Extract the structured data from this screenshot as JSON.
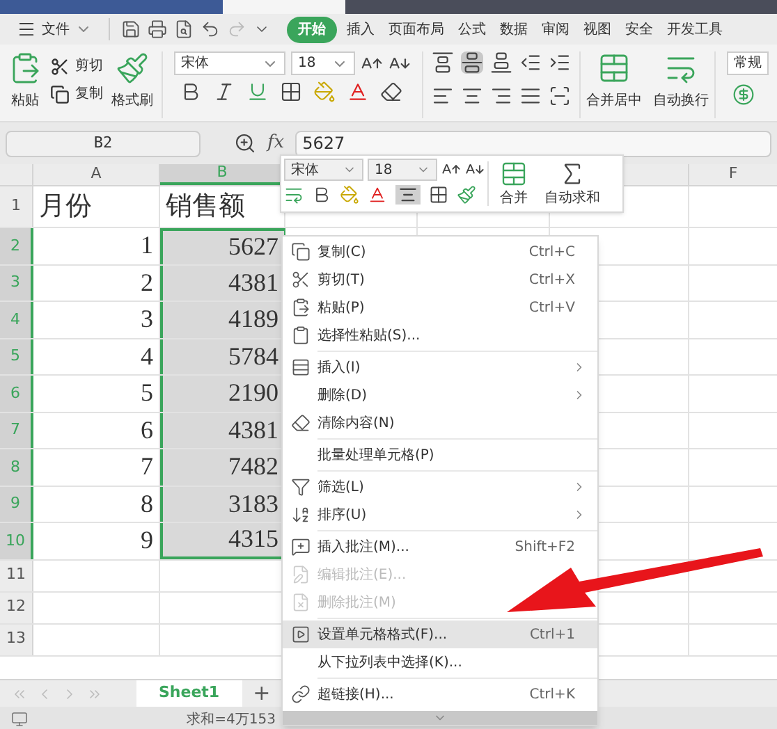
{
  "menu_bar": {
    "file_menu": "文件",
    "tabs": [
      {
        "label": "开始",
        "selected": true
      },
      {
        "label": "插入",
        "selected": false
      },
      {
        "label": "页面布局",
        "selected": false
      },
      {
        "label": "公式",
        "selected": false
      },
      {
        "label": "数据",
        "selected": false
      },
      {
        "label": "审阅",
        "selected": false
      },
      {
        "label": "视图",
        "selected": false
      },
      {
        "label": "安全",
        "selected": false
      },
      {
        "label": "开发工具",
        "selected": false
      }
    ]
  },
  "ribbon": {
    "paste": "粘贴",
    "cut": "剪切",
    "copy": "复制",
    "format_painter": "格式刷",
    "font": "宋体",
    "font_size": "18",
    "merge_center": "合并居中",
    "wrap_text": "自动换行",
    "number_format": "常规"
  },
  "formula_bar": {
    "name_box": "B2",
    "function_label": "fx",
    "formula": "5627"
  },
  "mini_toolbar": {
    "font": "宋体",
    "font_size": "18",
    "merge": "合并",
    "autosum": "自动求和"
  },
  "sheet": {
    "columns": [
      {
        "label": "A",
        "selected": false
      },
      {
        "label": "B",
        "selected": true
      },
      {
        "label": "F",
        "selected": false
      }
    ],
    "rows": [
      {
        "label": "1",
        "selected": false,
        "cells": [
          "月份",
          "销售额"
        ]
      },
      {
        "label": "2",
        "selected": true,
        "cells": [
          "1",
          "5627"
        ]
      },
      {
        "label": "3",
        "selected": true,
        "cells": [
          "2",
          "4381"
        ]
      },
      {
        "label": "4",
        "selected": true,
        "cells": [
          "3",
          "4189"
        ]
      },
      {
        "label": "5",
        "selected": true,
        "cells": [
          "4",
          "5784"
        ]
      },
      {
        "label": "6",
        "selected": true,
        "cells": [
          "5",
          "2190"
        ]
      },
      {
        "label": "7",
        "selected": true,
        "cells": [
          "6",
          "4381"
        ]
      },
      {
        "label": "8",
        "selected": true,
        "cells": [
          "7",
          "7482"
        ]
      },
      {
        "label": "9",
        "selected": true,
        "cells": [
          "8",
          "3183"
        ]
      },
      {
        "label": "10",
        "selected": true,
        "cells": [
          "9",
          "4315"
        ]
      },
      {
        "label": "11",
        "selected": false
      },
      {
        "label": "12",
        "selected": false
      },
      {
        "label": "13",
        "selected": false
      }
    ]
  },
  "context_menu": [
    {
      "kind": "item",
      "label": "复制(C)",
      "shortcut": "Ctrl+C",
      "disabled": false,
      "selected": false,
      "submenu": false
    },
    {
      "kind": "item",
      "label": "剪切(T)",
      "shortcut": "Ctrl+X",
      "disabled": false,
      "selected": false,
      "submenu": false
    },
    {
      "kind": "item",
      "label": "粘贴(P)",
      "shortcut": "Ctrl+V",
      "disabled": false,
      "selected": false,
      "submenu": false
    },
    {
      "kind": "item",
      "label": "选择性粘贴(S)...",
      "disabled": false,
      "selected": false,
      "submenu": false
    },
    {
      "kind": "separator"
    },
    {
      "kind": "item",
      "label": "插入(I)",
      "disabled": false,
      "selected": false,
      "submenu": true
    },
    {
      "kind": "item",
      "label": "删除(D)",
      "disabled": false,
      "selected": false,
      "submenu": true
    },
    {
      "kind": "item",
      "label": "清除内容(N)",
      "disabled": false,
      "selected": false,
      "submenu": false
    },
    {
      "kind": "separator"
    },
    {
      "kind": "item",
      "label": "批量处理单元格(P)",
      "disabled": false,
      "selected": false,
      "submenu": false
    },
    {
      "kind": "separator"
    },
    {
      "kind": "item",
      "label": "筛选(L)",
      "disabled": false,
      "selected": false,
      "submenu": true
    },
    {
      "kind": "item",
      "label": "排序(U)",
      "disabled": false,
      "selected": false,
      "submenu": true
    },
    {
      "kind": "separator"
    },
    {
      "kind": "item",
      "label": "插入批注(M)...",
      "shortcut": "Shift+F2",
      "disabled": false,
      "selected": false,
      "submenu": false
    },
    {
      "kind": "item",
      "label": "编辑批注(E)...",
      "disabled": true,
      "selected": false,
      "submenu": false
    },
    {
      "kind": "item",
      "label": "删除批注(M)",
      "disabled": true,
      "selected": false,
      "submenu": false
    },
    {
      "kind": "separator"
    },
    {
      "kind": "item",
      "label": "设置单元格格式(F)...",
      "shortcut": "Ctrl+1",
      "disabled": false,
      "selected": true,
      "submenu": false
    },
    {
      "kind": "item",
      "label": "从下拉列表中选择(K)...",
      "disabled": false,
      "selected": false,
      "submenu": false
    },
    {
      "kind": "separator"
    },
    {
      "kind": "item",
      "label": "超链接(H)...",
      "shortcut": "Ctrl+K",
      "disabled": false,
      "selected": false,
      "submenu": false
    }
  ],
  "sheet_tabs": {
    "tabs": [
      {
        "label": "Sheet1",
        "selected": true
      }
    ],
    "add": "+"
  },
  "status_bar": {
    "summary": "求和=4万153"
  }
}
